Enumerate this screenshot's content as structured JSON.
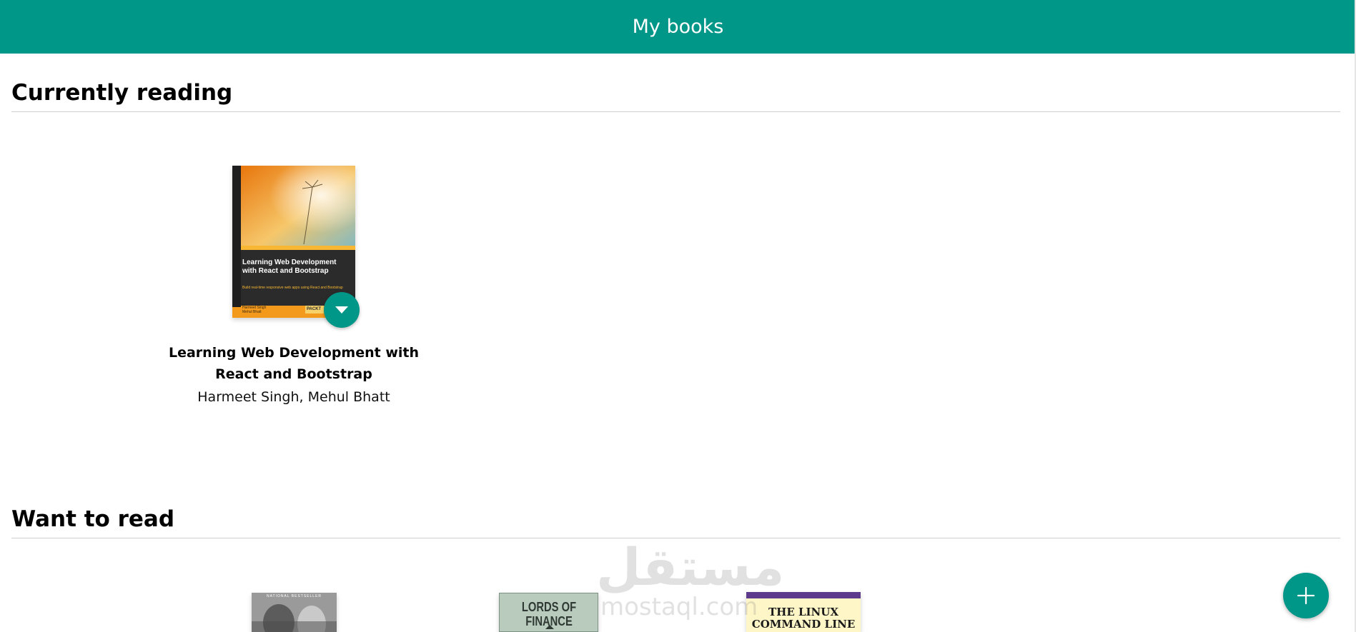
{
  "header": {
    "title": "My books"
  },
  "shelves": [
    {
      "title": "Currently reading",
      "books": [
        {
          "title": "Learning Web Development with React and Bootstrap",
          "authors": "Harmeet Singh, Mehul Bhatt",
          "cover": {
            "title": "Learning Web Development with React and Bootstrap",
            "subtitle": "Build real-time responsive web apps using React and Bootstrap",
            "authors": "Harmeet Singh\nMehul Bhatt",
            "publisher": "PACKT",
            "colors": {
              "top": "#f39a1c",
              "band": "#2b2b2b",
              "bottom": "#f39a1c",
              "accent": "#f7b733"
            }
          }
        }
      ]
    },
    {
      "title": "Want to read",
      "books": [
        {
          "cover": {
            "text": "NATIONAL BESTSELLER",
            "colors": {
              "bg": "#8a8a8a"
            }
          }
        },
        {
          "cover": {
            "text": "LORDS OF FINANCE",
            "colors": {
              "bg": "#b9cbbd",
              "text": "#2f3a34"
            }
          }
        },
        {
          "cover": {
            "text": "THE LINUX COMMAND LINE",
            "colors": {
              "bg": "#fff6c8",
              "band": "#5e3a8c",
              "text": "#1a1a1a"
            }
          }
        }
      ]
    }
  ],
  "watermark": {
    "arabic": "مستقل",
    "latin": "mostaql.com"
  },
  "colors": {
    "primary": "#009688",
    "white": "#ffffff"
  },
  "icons": {
    "shelf_changer": "triangle-down-icon",
    "add": "plus-icon"
  }
}
